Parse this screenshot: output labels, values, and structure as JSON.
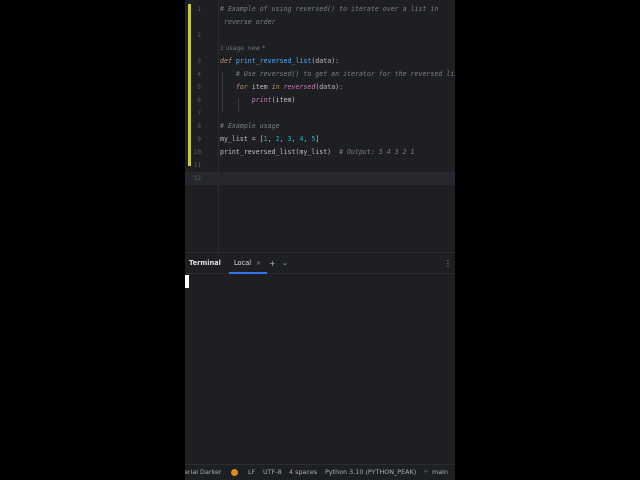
{
  "editor": {
    "lines": [
      {
        "num": "1",
        "tokens": [
          {
            "t": "# Example of using reversed() to iterate over a list in",
            "c": "c-comment"
          }
        ]
      },
      {
        "num": "",
        "tokens": [
          {
            "t": " reverse order",
            "c": "c-comment"
          }
        ]
      },
      {
        "num": "2",
        "tokens": []
      },
      {
        "num": "",
        "tokens": [
          {
            "t": "1 usage  new *",
            "c": "c-hint"
          }
        ]
      },
      {
        "num": "3",
        "tokens": [
          {
            "t": "def ",
            "c": "c-kw"
          },
          {
            "t": "print_reversed_list",
            "c": "c-fn"
          },
          {
            "t": "(data):",
            "c": "c-var"
          }
        ]
      },
      {
        "num": "4",
        "tokens": [
          {
            "t": "    # Use reversed() to get an iterator for the reversed lis",
            "c": "c-comment"
          }
        ]
      },
      {
        "num": "5",
        "tokens": [
          {
            "t": "    ",
            "c": "c-var"
          },
          {
            "t": "for ",
            "c": "c-kw"
          },
          {
            "t": "item ",
            "c": "c-var"
          },
          {
            "t": "in ",
            "c": "c-kw"
          },
          {
            "t": "reversed",
            "c": "c-builtin"
          },
          {
            "t": "(data):",
            "c": "c-var"
          }
        ]
      },
      {
        "num": "6",
        "tokens": [
          {
            "t": "        ",
            "c": "c-var"
          },
          {
            "t": "print",
            "c": "c-builtin"
          },
          {
            "t": "(item)",
            "c": "c-var"
          }
        ]
      },
      {
        "num": "7",
        "tokens": []
      },
      {
        "num": "8",
        "tokens": [
          {
            "t": "# Example usage",
            "c": "c-comment"
          }
        ]
      },
      {
        "num": "9",
        "tokens": [
          {
            "t": "my_list = [",
            "c": "c-var"
          },
          {
            "t": "1",
            "c": "c-num"
          },
          {
            "t": ", ",
            "c": "c-var"
          },
          {
            "t": "2",
            "c": "c-num"
          },
          {
            "t": ", ",
            "c": "c-var"
          },
          {
            "t": "3",
            "c": "c-num"
          },
          {
            "t": ", ",
            "c": "c-var"
          },
          {
            "t": "4",
            "c": "c-num"
          },
          {
            "t": ", ",
            "c": "c-var"
          },
          {
            "t": "5",
            "c": "c-num"
          },
          {
            "t": "]",
            "c": "c-var"
          }
        ]
      },
      {
        "num": "10",
        "tokens": [
          {
            "t": "print_reversed_list(my_list)  ",
            "c": "c-var"
          },
          {
            "t": "# Output: 5 4 3 2 1",
            "c": "c-comment"
          }
        ]
      },
      {
        "num": "11",
        "tokens": []
      },
      {
        "num": "12",
        "tokens": []
      }
    ]
  },
  "terminal": {
    "title": "Terminal",
    "tab_label": "Local",
    "tab_close": "×",
    "add_icon": "+",
    "dropdown_icon": "⌄",
    "more_icon": "⋮"
  },
  "statusbar": {
    "theme": "erial Darker",
    "line_ending": "LF",
    "encoding": "UTF-8",
    "indent": "4 spaces",
    "interpreter": "Python 3.10 (PYTHON_PEAK)",
    "branch_icon": "⑂",
    "branch": "main"
  },
  "colors": {
    "accent": "#3574f0",
    "change_marker": "#c8c84a",
    "status_dot": "#e08a1e"
  }
}
